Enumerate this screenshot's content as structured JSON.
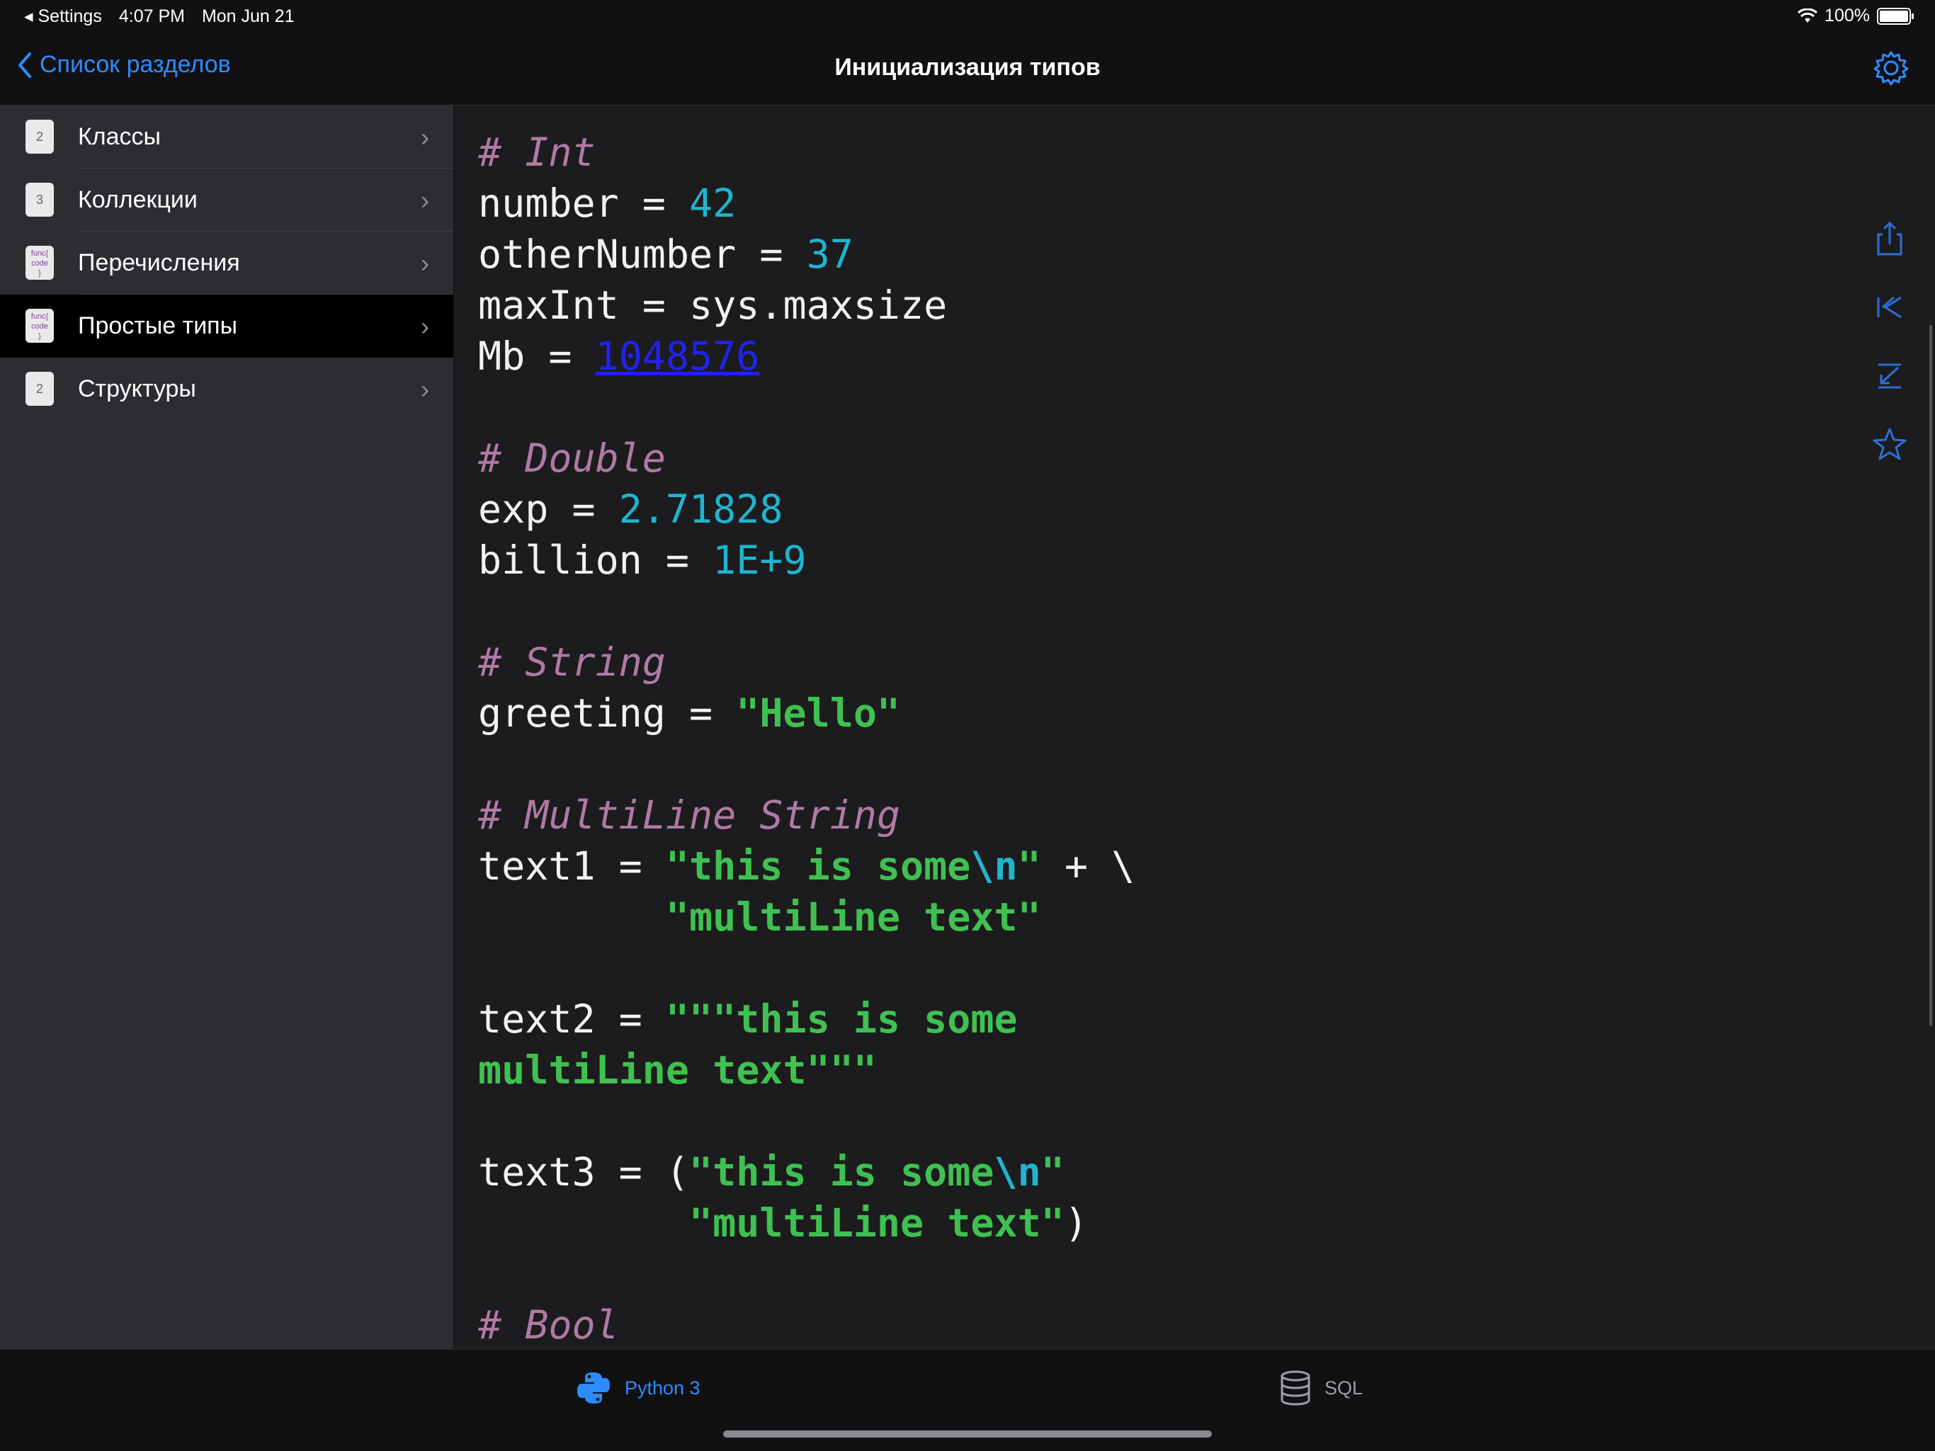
{
  "status": {
    "back_app": "Settings",
    "time": "4:07 PM",
    "date": "Mon Jun 21",
    "battery": "100%",
    "battery_level": 1.0
  },
  "nav": {
    "back_label": "Список разделов",
    "title": "Инициализация типов"
  },
  "sidebar": {
    "items": [
      {
        "label": "Классы",
        "thumb": "2"
      },
      {
        "label": "Коллекции",
        "thumb": "3"
      },
      {
        "label": "Перечисления",
        "thumb": "func"
      },
      {
        "label": "Простые типы",
        "thumb": "func"
      },
      {
        "label": "Структуры",
        "thumb": "2"
      }
    ],
    "active_index": 3
  },
  "code": {
    "comment_int": "# Int",
    "line_number": [
      "number = ",
      "42"
    ],
    "line_other": [
      "otherNumber = ",
      "37"
    ],
    "line_maxint": "maxInt = sys.maxsize",
    "line_mb": [
      "Mb = ",
      "1048576"
    ],
    "comment_double": "# Double",
    "line_exp": [
      "exp = ",
      "2.71828"
    ],
    "line_billion": [
      "billion = ",
      "1E+9"
    ],
    "comment_string": "# String",
    "line_greeting": [
      "greeting = ",
      "\"Hello\""
    ],
    "comment_multiline": "# MultiLine String",
    "text1_a": [
      "text1 = ",
      "\"this is some",
      "\\n",
      "\"",
      " + \\"
    ],
    "text1_b": [
      "        ",
      "\"multiLine text\""
    ],
    "text2_a": [
      "text2 = ",
      "\"\"\"this is some"
    ],
    "text2_b": [
      "multiLine text\"\"\""
    ],
    "text3_a": [
      "text3 = (",
      "\"this is some",
      "\\n",
      "\""
    ],
    "text3_b": [
      "         ",
      "\"multiLine text\"",
      ")"
    ],
    "comment_bool": "# Bool"
  },
  "tabs": [
    {
      "label": "Python 3",
      "icon": "python-icon",
      "active": true
    },
    {
      "label": "SQL",
      "icon": "database-icon",
      "active": false
    }
  ],
  "colors": {
    "accent": "#2d8cff",
    "comment": "#b07aa5",
    "number": "#1fb5d0",
    "string": "#3fc151"
  }
}
